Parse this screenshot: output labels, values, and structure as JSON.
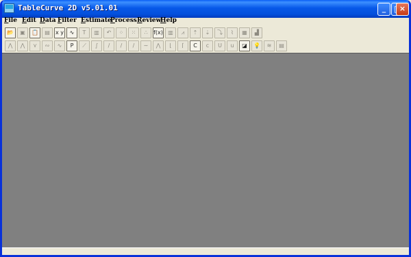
{
  "window": {
    "title": "TableCurve 2D v5.01.01"
  },
  "title_buttons": {
    "minimize": "_",
    "maximize": "□",
    "close": "×"
  },
  "menu": [
    "File",
    "Edit",
    "Data",
    "Filter",
    "Estimate",
    "Process",
    "Review",
    "Help"
  ],
  "toolbar1": [
    {
      "name": "open-icon",
      "glyph": "📂"
    },
    {
      "name": "import-icon",
      "glyph": "▣"
    },
    {
      "name": "paste-icon",
      "glyph": "📋"
    },
    {
      "name": "save-icon",
      "glyph": "▤"
    },
    {
      "name": "xy-data-icon",
      "glyph": "x y"
    },
    {
      "name": "curve-wave-icon",
      "glyph": "∿"
    },
    {
      "name": "text-icon",
      "glyph": "T"
    },
    {
      "name": "table-icon",
      "glyph": "▥"
    },
    {
      "name": "undo-icon",
      "glyph": "↶"
    },
    {
      "name": "scatter-icon",
      "glyph": "⁘"
    },
    {
      "name": "scatter-fit-icon",
      "glyph": "⁙"
    },
    {
      "name": "points-icon",
      "glyph": "∴"
    },
    {
      "name": "function-icon",
      "glyph": "f(x)"
    },
    {
      "name": "bar-chart-icon",
      "glyph": "▥"
    },
    {
      "name": "line-up-icon",
      "glyph": "⩘"
    },
    {
      "name": "arrow-up-icon",
      "glyph": "⇡"
    },
    {
      "name": "arrow-down-icon",
      "glyph": "⇣"
    },
    {
      "name": "curve-down-icon",
      "glyph": "⤵"
    },
    {
      "name": "curve-fit-icon",
      "glyph": "⌇"
    },
    {
      "name": "report-icon",
      "glyph": "▦"
    },
    {
      "name": "chart-area-icon",
      "glyph": "▟"
    }
  ],
  "toolbar2": [
    {
      "name": "peak-fit-icon",
      "glyph": "⋀"
    },
    {
      "name": "peak-fit-2-icon",
      "glyph": "⋀"
    },
    {
      "name": "transition-icon",
      "glyph": "⋎"
    },
    {
      "name": "waveform-icon",
      "glyph": "∾"
    },
    {
      "name": "spline-icon",
      "glyph": "∿"
    },
    {
      "name": "polynomial-icon",
      "glyph": "P"
    },
    {
      "name": "rational-icon",
      "glyph": "⟋"
    },
    {
      "name": "sigmoid-icon",
      "glyph": "∫"
    },
    {
      "name": "line-icon",
      "glyph": "/"
    },
    {
      "name": "line-2-icon",
      "glyph": "/"
    },
    {
      "name": "line-3-icon",
      "glyph": "/"
    },
    {
      "name": "wave-icon",
      "glyph": "∼"
    },
    {
      "name": "gaussian-peak-icon",
      "glyph": "⋀"
    },
    {
      "name": "decay-icon",
      "glyph": "⌊"
    },
    {
      "name": "growth-icon",
      "glyph": "⌈"
    },
    {
      "name": "custom-c-icon",
      "glyph": "C"
    },
    {
      "name": "custom-c-italic-icon",
      "glyph": "c"
    },
    {
      "name": "user-function-icon",
      "glyph": "U"
    },
    {
      "name": "user-function-2-icon",
      "glyph": "u"
    },
    {
      "name": "diagonal-fit-icon",
      "glyph": "◪"
    },
    {
      "name": "lightbulb-icon",
      "glyph": "💡"
    },
    {
      "name": "graph-wave-icon",
      "glyph": "≋"
    },
    {
      "name": "notebook-icon",
      "glyph": "▤"
    }
  ]
}
